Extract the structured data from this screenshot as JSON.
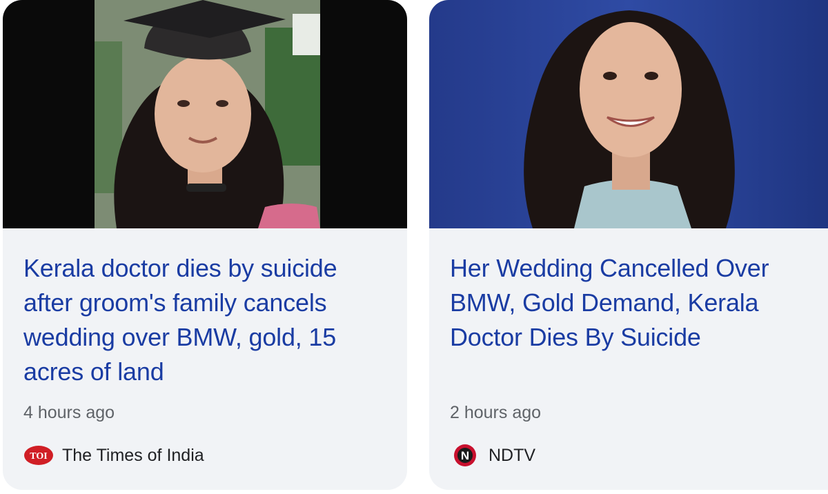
{
  "cards": [
    {
      "headline": "Kerala doctor dies by suicide after groom's family cancels wedding over BMW, gold, 15 acres of land",
      "time": "4 hours ago",
      "source": "The Times of India",
      "source_logo_text": "TOI",
      "source_logo_icon": "toi-logo-icon",
      "image_icon": "news-photo"
    },
    {
      "headline": "Her Wedding Cancelled Over BMW, Gold Demand, Kerala Doctor Dies By Suicide",
      "time": "2 hours ago",
      "source": "NDTV",
      "source_logo_text": "N",
      "source_logo_icon": "ndtv-logo-icon",
      "image_icon": "news-photo"
    }
  ],
  "colors": {
    "headline": "#1a3ca3",
    "card_background": "#f1f3f6",
    "meta_text": "#5f6368",
    "source_text": "#202124",
    "toi_red": "#d01e25",
    "ndtv_red": "#c8102e"
  }
}
